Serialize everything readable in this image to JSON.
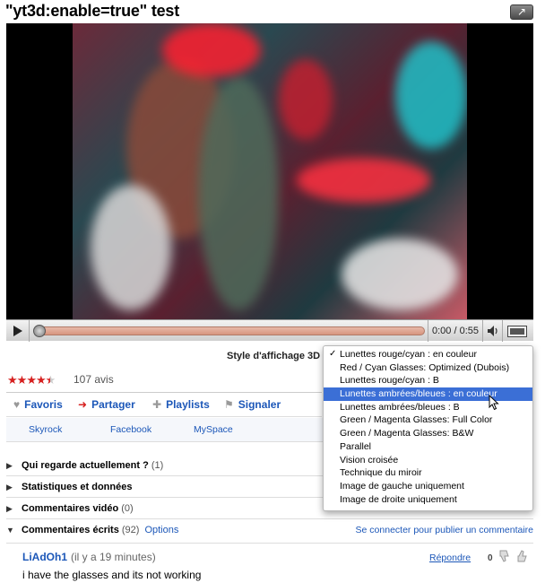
{
  "video": {
    "title": "\"yt3d:enable=true\" test",
    "time": "0:00 / 0:55",
    "progress": 0.0
  },
  "display_style": {
    "label": "Style d'affichage 3D",
    "options": [
      "Lunettes rouge/cyan : en couleur",
      "Red / Cyan Glasses: Optimized (Dubois)",
      "Lunettes rouge/cyan : B",
      "Lunettes ambrées/bleues : en couleur",
      "Lunettes ambrées/bleues : B",
      "Green / Magenta Glasses: Full Color",
      "Green / Magenta Glasses: B&W",
      "Parallel",
      "Vision croisée",
      "Technique du miroir",
      "Image de gauche uniquement",
      "Image de droite uniquement"
    ],
    "checked_index": 0,
    "highlighted_index": 3
  },
  "rating": {
    "stars": 4.5,
    "reviews": "107 avis"
  },
  "actions": {
    "favorites": "Favoris",
    "share": "Partager",
    "playlists": "Playlists",
    "flag": "Signaler"
  },
  "share_sites": [
    "Skyrock",
    "Facebook",
    "MySpace"
  ],
  "sections": {
    "watching": {
      "title": "Qui regarde actuellement ?",
      "count": "(1)"
    },
    "stats": {
      "title": "Statistiques et données"
    },
    "video_comments": {
      "title": "Commentaires vidéo",
      "count": "(0)"
    },
    "written_comments": {
      "title": "Commentaires écrits",
      "count": "(92)",
      "options": "Options",
      "signin": "Se connecter pour publier un commentaire"
    }
  },
  "comment": {
    "author": "LiAdOh1",
    "time": "(il y a 19 minutes)",
    "reply": "Répondre",
    "score": "0",
    "text": "i have the glasses and its not working"
  },
  "colors": {
    "link": "#1c57b8",
    "highlight": "#3b6fd6",
    "star": "#d6201f"
  }
}
